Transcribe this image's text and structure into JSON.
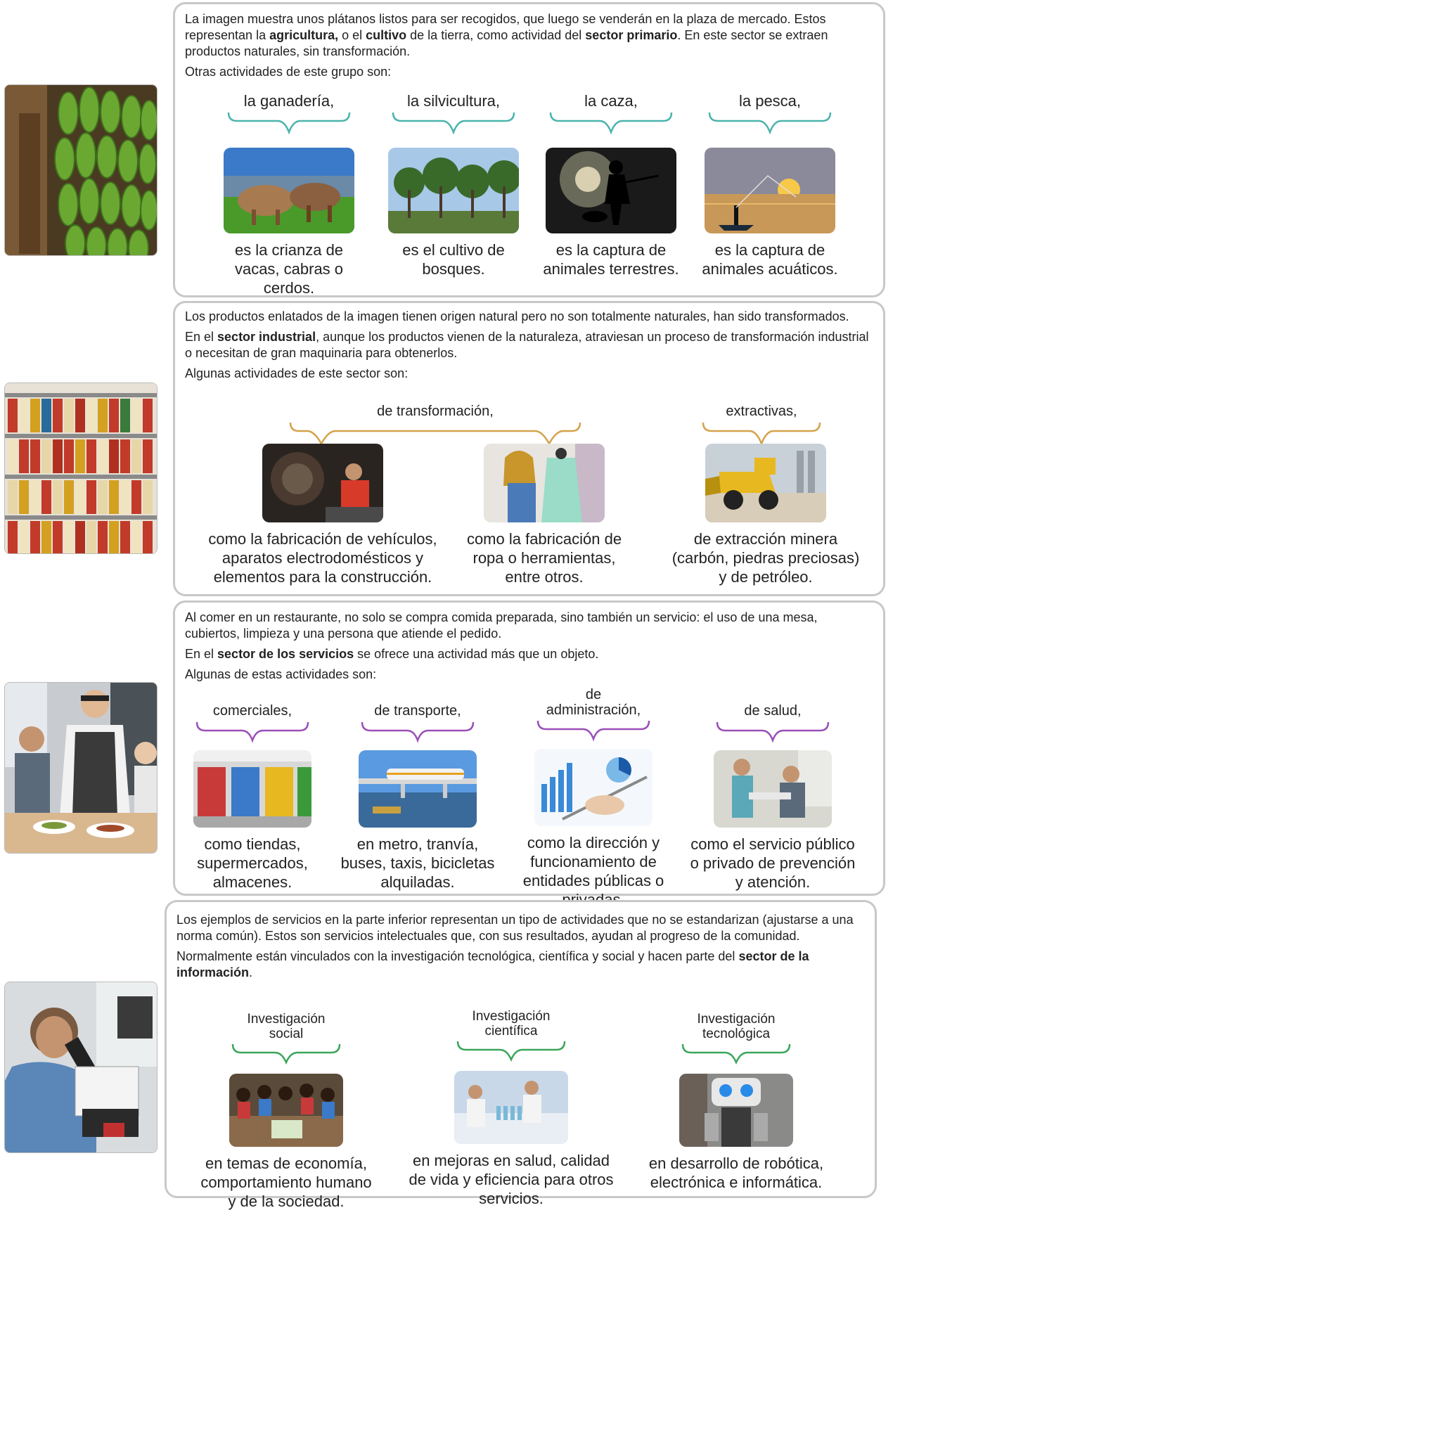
{
  "sections": [
    {
      "intro": [
        {
          "parts": [
            {
              "t": "La imagen muestra unos plátanos listos para ser recogidos, que luego se venderán en la plaza de mercado. Estos representan la "
            },
            {
              "t": "agricultura,",
              "b": true
            },
            {
              "t": " o el "
            },
            {
              "t": "cultivo",
              "b": true
            },
            {
              "t": " de la tierra, como actividad del "
            },
            {
              "t": "sector primario",
              "b": true
            },
            {
              "t": ". En este sector se extraen productos naturales, sin transformación."
            }
          ]
        },
        {
          "parts": [
            {
              "t": "Otras actividades de este grupo son:"
            }
          ]
        }
      ],
      "items": [
        {
          "label": "la ganadería,",
          "desc": "es la crianza de vacas, cabras o cerdos."
        },
        {
          "label": "la silvicultura,",
          "desc": "es el cultivo de bosques."
        },
        {
          "label": "la caza,",
          "desc": "es la captura de animales terrestres."
        },
        {
          "label": "la pesca,",
          "desc": "es la captura de animales acuáticos."
        }
      ]
    },
    {
      "intro": [
        {
          "parts": [
            {
              "t": "Los productos enlatados de la imagen tienen origen natural pero no son totalmente naturales, han sido transformados."
            }
          ]
        },
        {
          "parts": [
            {
              "t": "En el "
            },
            {
              "t": "sector industrial",
              "b": true
            },
            {
              "t": ", aunque los productos vienen de la naturaleza, atraviesan un proceso de transformación industrial o necesitan de gran maquinaria para obtenerlos."
            }
          ]
        },
        {
          "parts": [
            {
              "t": "Algunas actividades de este sector son:"
            }
          ]
        }
      ],
      "groups": [
        {
          "label": "de transformación,"
        },
        {
          "label": "extractivas,"
        }
      ],
      "items": [
        {
          "desc": "como la fabricación de vehículos, aparatos electrodomésticos y elementos para la construcción."
        },
        {
          "desc": "como la fabricación de ropa o herramientas, entre otros."
        },
        {
          "desc": "de extracción minera (carbón, piedras preciosas) y de petróleo."
        }
      ]
    },
    {
      "intro": [
        {
          "parts": [
            {
              "t": "Al comer en un restaurante, no solo se compra comida preparada, sino también un servicio: el uso de una mesa, cubiertos, limpieza y una persona que atiende el pedido."
            }
          ]
        },
        {
          "parts": [
            {
              "t": "En el "
            },
            {
              "t": "sector de los servicios",
              "b": true
            },
            {
              "t": " se ofrece una actividad más que un objeto."
            }
          ]
        },
        {
          "parts": [
            {
              "t": "Algunas de estas actividades son:"
            }
          ]
        }
      ],
      "items": [
        {
          "label": "comerciales,",
          "desc": "como tiendas, supermercados, almacenes."
        },
        {
          "label": "de transporte,",
          "desc": "en metro, tranvía, buses, taxis, bicicletas alquiladas."
        },
        {
          "label": "de\nadministración,",
          "desc": "como la dirección y funcionamiento de entidades públicas o privadas."
        },
        {
          "label": "de salud,",
          "desc": "como el servicio público o privado de prevención y atención."
        }
      ]
    },
    {
      "intro": [
        {
          "parts": [
            {
              "t": "Los ejemplos de servicios en la parte inferior representan un tipo de actividades que no se estandarizan (ajustarse a una norma común). Estos son servicios intelectuales que, con sus resultados, ayudan al progreso de la comunidad."
            }
          ]
        },
        {
          "parts": [
            {
              "t": "Normalmente están vinculados con la investigación tecnológica, científica y social y hacen parte del "
            },
            {
              "t": "sector de la información",
              "b": true
            },
            {
              "t": "."
            }
          ]
        }
      ],
      "items": [
        {
          "label": "Investigación\nsocial",
          "desc": "en temas de economía, comportamiento humano y de la sociedad."
        },
        {
          "label": "Investigación\ncientífica",
          "desc": "en mejoras en salud, calidad de vida y eficiencia para otros servicios."
        },
        {
          "label": "Investigación\ntecnológica",
          "desc": "en desarrollo de robótica, electrónica e informática."
        }
      ]
    }
  ],
  "colors": {
    "panel_border": "#c8c8c8",
    "brace_primary": "#4bb3ad",
    "brace_industrial": "#d4a24a",
    "brace_services": "#9b4fb8",
    "brace_information": "#3aa65a"
  }
}
